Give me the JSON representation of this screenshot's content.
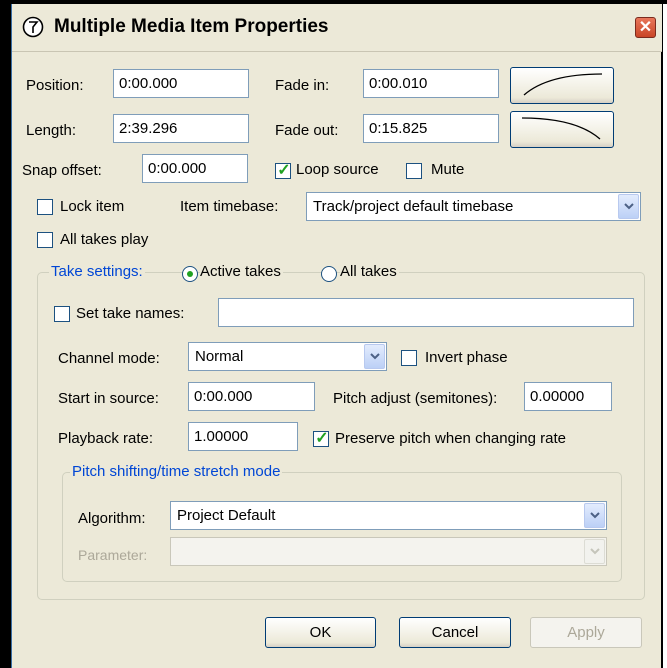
{
  "window": {
    "title": "Multiple Media Item Properties",
    "close_label": "✕"
  },
  "item": {
    "position_label": "Position:",
    "position_value": "0:00.000",
    "fade_in_label": "Fade in:",
    "fade_in_value": "0:00.010",
    "length_label": "Length:",
    "length_value": "2:39.296",
    "fade_out_label": "Fade out:",
    "fade_out_value": "0:15.825",
    "snap_offset_label": "Snap offset:",
    "snap_offset_value": "0:00.000",
    "loop_source_label": "Loop source",
    "loop_source_checked": true,
    "mute_label": "Mute",
    "mute_checked": false,
    "lock_item_label": "Lock item",
    "lock_item_checked": false,
    "item_timebase_label": "Item timebase:",
    "item_timebase_value": "Track/project default timebase",
    "all_takes_play_label": "All takes play",
    "all_takes_play_checked": false
  },
  "take": {
    "group_label": "Take settings:",
    "active_takes_label": "Active takes",
    "all_takes_label": "All takes",
    "selected_scope": "Active takes",
    "set_take_names_label": "Set take names:",
    "set_take_names_checked": false,
    "take_name_value": "",
    "channel_mode_label": "Channel mode:",
    "channel_mode_value": "Normal",
    "invert_phase_label": "Invert phase",
    "invert_phase_checked": false,
    "start_in_source_label": "Start in source:",
    "start_in_source_value": "0:00.000",
    "pitch_adjust_label": "Pitch adjust (semitones):",
    "pitch_adjust_value": "0.00000",
    "playback_rate_label": "Playback rate:",
    "playback_rate_value": "1.00000",
    "preserve_pitch_label": "Preserve pitch when changing rate",
    "preserve_pitch_checked": true
  },
  "pitch": {
    "group_label": "Pitch shifting/time stretch mode",
    "algorithm_label": "Algorithm:",
    "algorithm_value": "Project Default",
    "parameter_label": "Parameter:",
    "parameter_value": ""
  },
  "buttons": {
    "ok": "OK",
    "cancel": "Cancel",
    "apply": "Apply"
  },
  "colors": {
    "window_bg": "#ece9d8",
    "group_legend": "#0046d5",
    "check_tick": "#21a121",
    "disabled_text": "#aca899"
  }
}
